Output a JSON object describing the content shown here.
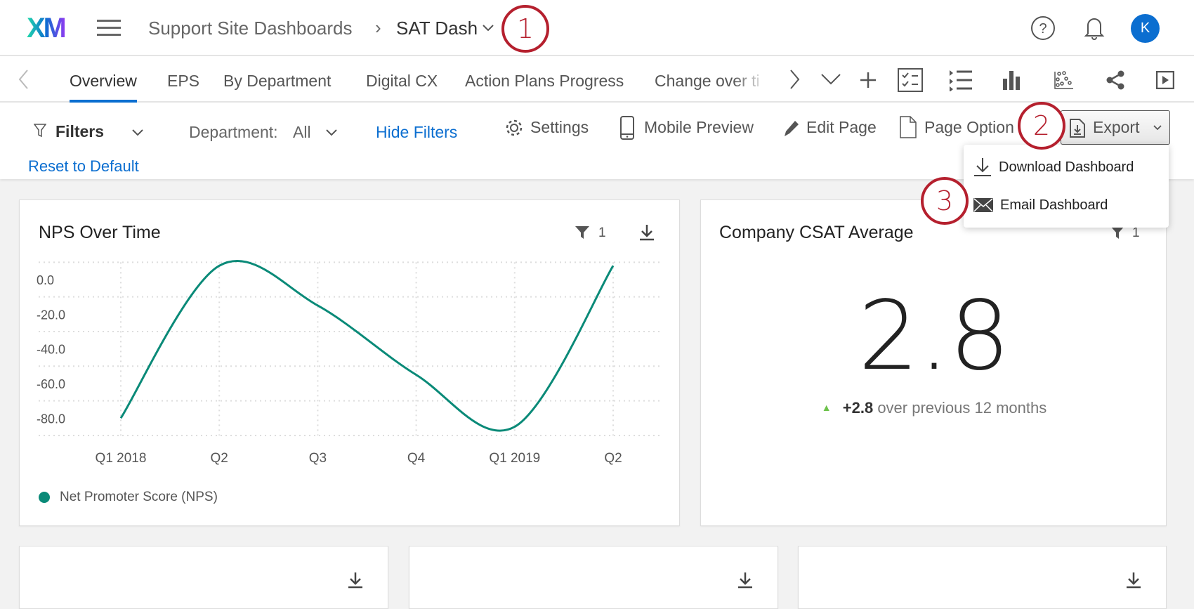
{
  "header": {
    "logo": "XM",
    "breadcrumb_parent": "Support Site Dashboards",
    "breadcrumb_current": "SAT Dash",
    "avatar_initial": "K"
  },
  "tabs": [
    "Overview",
    "EPS",
    "By Department",
    "Digital CX",
    "Action Plans Progress",
    "Change over ti"
  ],
  "toolbar": {
    "filters_label": "Filters",
    "department_label": "Department:",
    "department_value": "All",
    "hide_filters": "Hide Filters",
    "reset": "Reset to Default",
    "settings": "Settings",
    "mobile_preview": "Mobile Preview",
    "edit_page": "Edit Page",
    "page_options": "Page Option",
    "export": "Export"
  },
  "export_menu": [
    "Download Dashboard",
    "Email Dashboard"
  ],
  "annotations": [
    "1",
    "2",
    "3"
  ],
  "widgets": {
    "nps": {
      "title": "NPS Over Time",
      "filter_count": "1",
      "legend": "Net Promoter Score (NPS)"
    },
    "csat": {
      "title": "Company CSAT Average",
      "filter_count": "1",
      "value": "2.8",
      "delta": "+2.8",
      "delta_text": "over previous 12 months"
    }
  },
  "colors": {
    "accent": "#0b6ed0",
    "series": "#0a8a78",
    "annotation": "#b5202e",
    "positive": "#6cc24a"
  },
  "chart_data": {
    "type": "line",
    "title": "NPS Over Time",
    "categories": [
      "Q1 2018",
      "Q2",
      "Q3",
      "Q4",
      "Q1 2019",
      "Q2"
    ],
    "series": [
      {
        "name": "Net Promoter Score (NPS)",
        "values": [
          -80,
          8,
          -15,
          -55,
          -85,
          8
        ]
      }
    ],
    "yticks": [
      "0.0",
      "-20.0",
      "-40.0",
      "-60.0",
      "-80.0"
    ],
    "ytick_values": [
      0,
      -20,
      -40,
      -60,
      -80
    ],
    "grid": true,
    "legend": "bottom-left"
  }
}
